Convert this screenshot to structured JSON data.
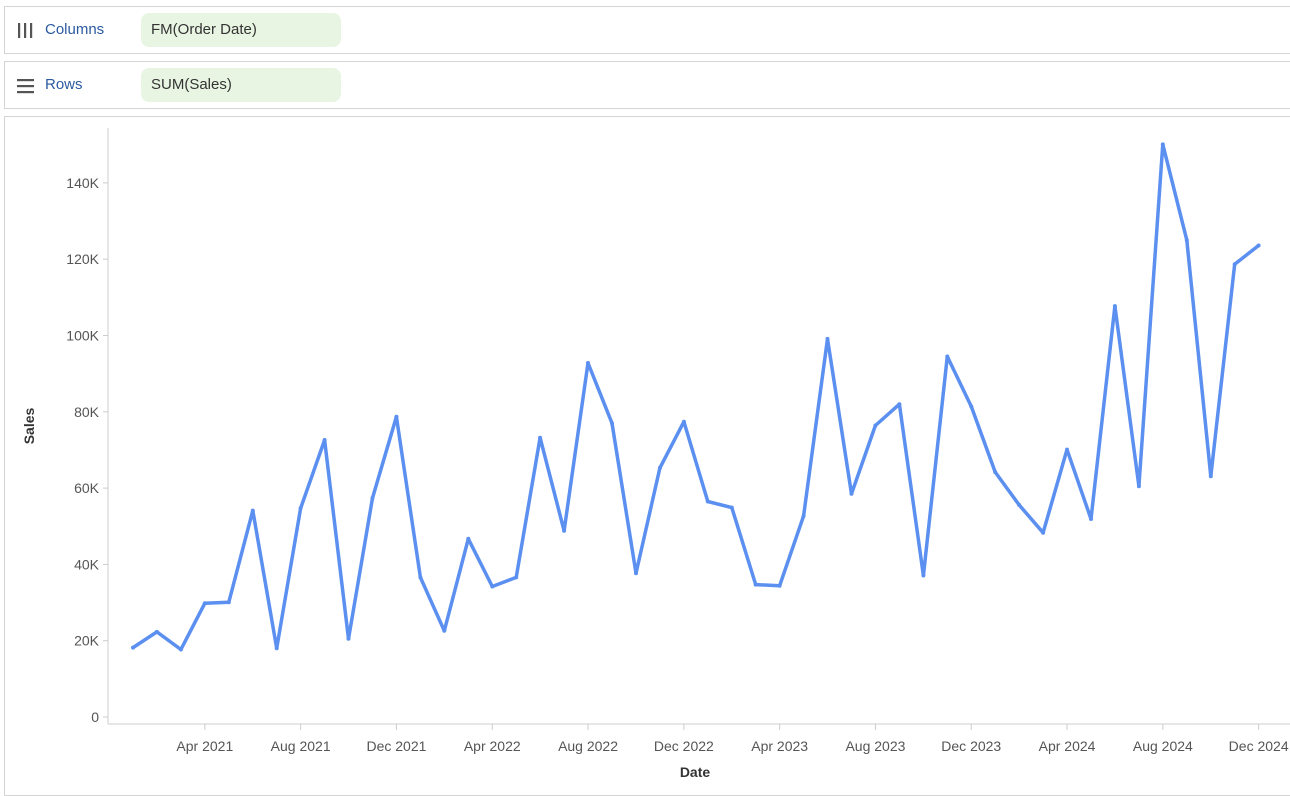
{
  "shelves": {
    "columns": {
      "label": "Columns",
      "pill": "FM(Order Date)"
    },
    "rows": {
      "label": "Rows",
      "pill": "SUM(Sales)"
    }
  },
  "colors": {
    "line": "#5b8ff0",
    "axis": "#cccccc",
    "pill_bg": "#e9f5e3",
    "shelf_label": "#2a5aa0"
  },
  "icons": {
    "columns": "columns-icon",
    "rows": "rows-icon"
  },
  "chart_data": {
    "type": "line",
    "title": "",
    "xlabel": "Date",
    "ylabel": "Sales",
    "ylim": [
      0,
      155000
    ],
    "grid": false,
    "x_ticks": [
      "Apr 2021",
      "Aug 2021",
      "Dec 2021",
      "Apr 2022",
      "Aug 2022",
      "Dec 2022",
      "Apr 2023",
      "Aug 2023",
      "Dec 2023",
      "Apr 2024",
      "Aug 2024",
      "Dec 2024"
    ],
    "y_ticks": [
      "0",
      "20K",
      "40K",
      "60K",
      "80K",
      "100K",
      "120K",
      "140K"
    ],
    "y_tick_values": [
      0,
      20000,
      40000,
      60000,
      80000,
      100000,
      120000,
      140000
    ],
    "x": [
      "Jan 2021",
      "Feb 2021",
      "Mar 2021",
      "Apr 2021",
      "May 2021",
      "Jun 2021",
      "Jul 2021",
      "Aug 2021",
      "Sep 2021",
      "Oct 2021",
      "Nov 2021",
      "Dec 2021",
      "Jan 2022",
      "Feb 2022",
      "Mar 2022",
      "Apr 2022",
      "May 2022",
      "Jun 2022",
      "Jul 2022",
      "Aug 2022",
      "Sep 2022",
      "Oct 2022",
      "Nov 2022",
      "Dec 2022",
      "Jan 2023",
      "Feb 2023",
      "Mar 2023",
      "Apr 2023",
      "May 2023",
      "Jun 2023",
      "Jul 2023",
      "Aug 2023",
      "Sep 2023",
      "Oct 2023",
      "Nov 2023",
      "Dec 2023",
      "Jan 2024",
      "Feb 2024",
      "Mar 2024",
      "Apr 2024",
      "May 2024",
      "Jun 2024",
      "Jul 2024",
      "Aug 2024",
      "Sep 2024",
      "Oct 2024",
      "Nov 2024",
      "Dec 2024"
    ],
    "series": [
      {
        "values": [
          18200,
          22300,
          17700,
          29800,
          30100,
          54100,
          18000,
          54700,
          72600,
          20500,
          57400,
          78700,
          36600,
          22600,
          46700,
          34200,
          36600,
          73200,
          48800,
          92800,
          77000,
          37700,
          65300,
          77400,
          56500,
          54900,
          34700,
          34400,
          52700,
          99100,
          58500,
          76400,
          82000,
          37100,
          94500,
          81400,
          64200,
          55600,
          48300,
          70100,
          51900,
          107700,
          60500,
          150100,
          125000,
          63100,
          118700,
          123600
        ]
      }
    ]
  }
}
